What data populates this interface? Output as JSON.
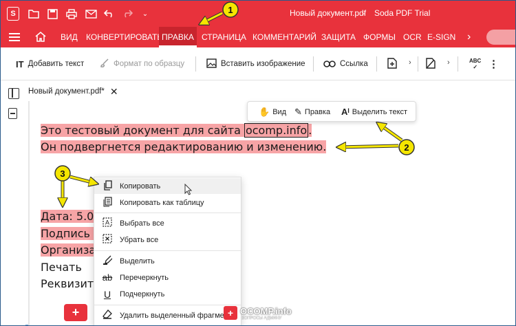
{
  "titlebar": {
    "app_logo": "S",
    "document_title": "Новый документ.pdf",
    "separator": "-",
    "app_title": "Soda PDF Trial",
    "icons": [
      "folder-icon",
      "save-icon",
      "print-icon",
      "mail-icon",
      "undo-icon",
      "redo-icon",
      "chevron-down-icon"
    ]
  },
  "menubar": {
    "items": [
      "ВИД",
      "КОНВЕРТИРОВАТЬ",
      "ПРАВКА",
      "СТРАНИЦА",
      "КОММЕНТАРИЙ",
      "ЗАЩИТА",
      "ФОРМЫ",
      "OCR",
      "E-SIGN"
    ],
    "active": "ПРАВКА",
    "more": "›"
  },
  "toolbar": {
    "add_text": "Добавить текст",
    "format_painter": "Формат по образцу",
    "insert_image": "Вставить изображение",
    "link": "Ссылка",
    "chevron": "›",
    "more": "⋮"
  },
  "tab": {
    "label": "Новый документ.pdf*",
    "close": "✕"
  },
  "minibar": {
    "view": "Вид",
    "edit": "Правка",
    "select_text": "Выделить текст"
  },
  "document": {
    "line1_before": "Это тестовый документ для сайта ",
    "line1_boxed": "ocomp.info",
    "line1_after": ".",
    "line2": "Он подвергнется редактированию и изменению.",
    "line3": "Дата: 5.0",
    "line4": "Подпись",
    "line5": "Организа",
    "line6": "Печать",
    "line7": "Реквизит"
  },
  "context_menu": {
    "items": [
      {
        "label": "Копировать",
        "icon": "copy-icon"
      },
      {
        "label": "Копировать как таблицу",
        "icon": "copy-table-icon"
      },
      {
        "label": "Выбрать все",
        "icon": "select-all-icon"
      },
      {
        "label": "Убрать все",
        "icon": "deselect-all-icon"
      },
      {
        "label": "Выделить",
        "icon": "highlighter-icon"
      },
      {
        "label": "Перечеркнуть",
        "icon": "strikethrough-icon"
      },
      {
        "label": "Подчеркнуть",
        "icon": "underline-icon"
      },
      {
        "label": "Удалить выделенный фрагмент",
        "icon": "eraser-icon"
      }
    ]
  },
  "annotations": {
    "badge1": "1",
    "badge2": "2",
    "badge3": "3",
    "color": "#f5e600"
  },
  "watermark": {
    "text": "OCOMP.info",
    "sub": "ВОПРОСЫ АДМИНУ"
  }
}
